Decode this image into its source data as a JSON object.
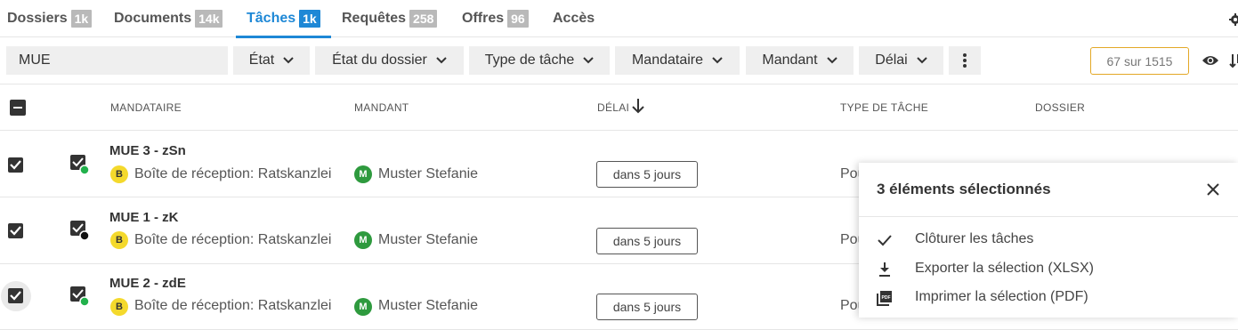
{
  "tabs": [
    {
      "label": "Dossiers",
      "count": "1k"
    },
    {
      "label": "Documents",
      "count": "14k"
    },
    {
      "label": "Tâches",
      "count": "1k"
    },
    {
      "label": "Requêtes",
      "count": "258"
    },
    {
      "label": "Offres",
      "count": "96"
    },
    {
      "label": "Accès",
      "count": ""
    }
  ],
  "active_tab": "Tâches",
  "search": {
    "value": "MUE"
  },
  "filters": [
    "État",
    "État du dossier",
    "Type de tâche",
    "Mandataire",
    "Mandant",
    "Délai"
  ],
  "result_count": "67 sur 1515",
  "columns": {
    "mandataire": "MANDATAIRE",
    "mandant": "MANDANT",
    "delai": "DÉLAI",
    "type": "TYPE DE TÂCHE",
    "dossier": "DOSSIER"
  },
  "rows": [
    {
      "title": "MUE 3 - zSn",
      "mandataire_initial": "B",
      "mandataire": "Boîte de réception: Ratskanzlei",
      "mandant_initial": "M",
      "mandant": "Muster Stefanie",
      "delai": "dans 5 jours",
      "type": "Pou",
      "status_color": "#22b14c"
    },
    {
      "title": "MUE 1 - zK",
      "mandataire_initial": "B",
      "mandataire": "Boîte de réception: Ratskanzlei",
      "mandant_initial": "M",
      "mandant": "Muster Stefanie",
      "delai": "dans 5 jours",
      "type": "Pou",
      "status_color": "#111111"
    },
    {
      "title": "MUE 2 - zdE",
      "mandataire_initial": "B",
      "mandataire": "Boîte de réception: Ratskanzlei",
      "mandant_initial": "M",
      "mandant": "Muster Stefanie",
      "delai": "dans 5 jours",
      "type": "Pou",
      "status_color": "#22b14c"
    }
  ],
  "selection_panel": {
    "title": "3 éléments sélectionnés",
    "actions": [
      {
        "label": "Clôturer les tâches",
        "icon": "check-icon"
      },
      {
        "label": "Exporter la sélection (XLSX)",
        "icon": "download-icon"
      },
      {
        "label": "Imprimer la sélection (PDF)",
        "icon": "pdf-icon"
      }
    ]
  },
  "colors": {
    "accent": "#1e88d6",
    "badge": "#b9b9b9",
    "count_border": "#e3a826",
    "avatar_b": "#f4d92c",
    "avatar_m": "#2e9a3e"
  }
}
